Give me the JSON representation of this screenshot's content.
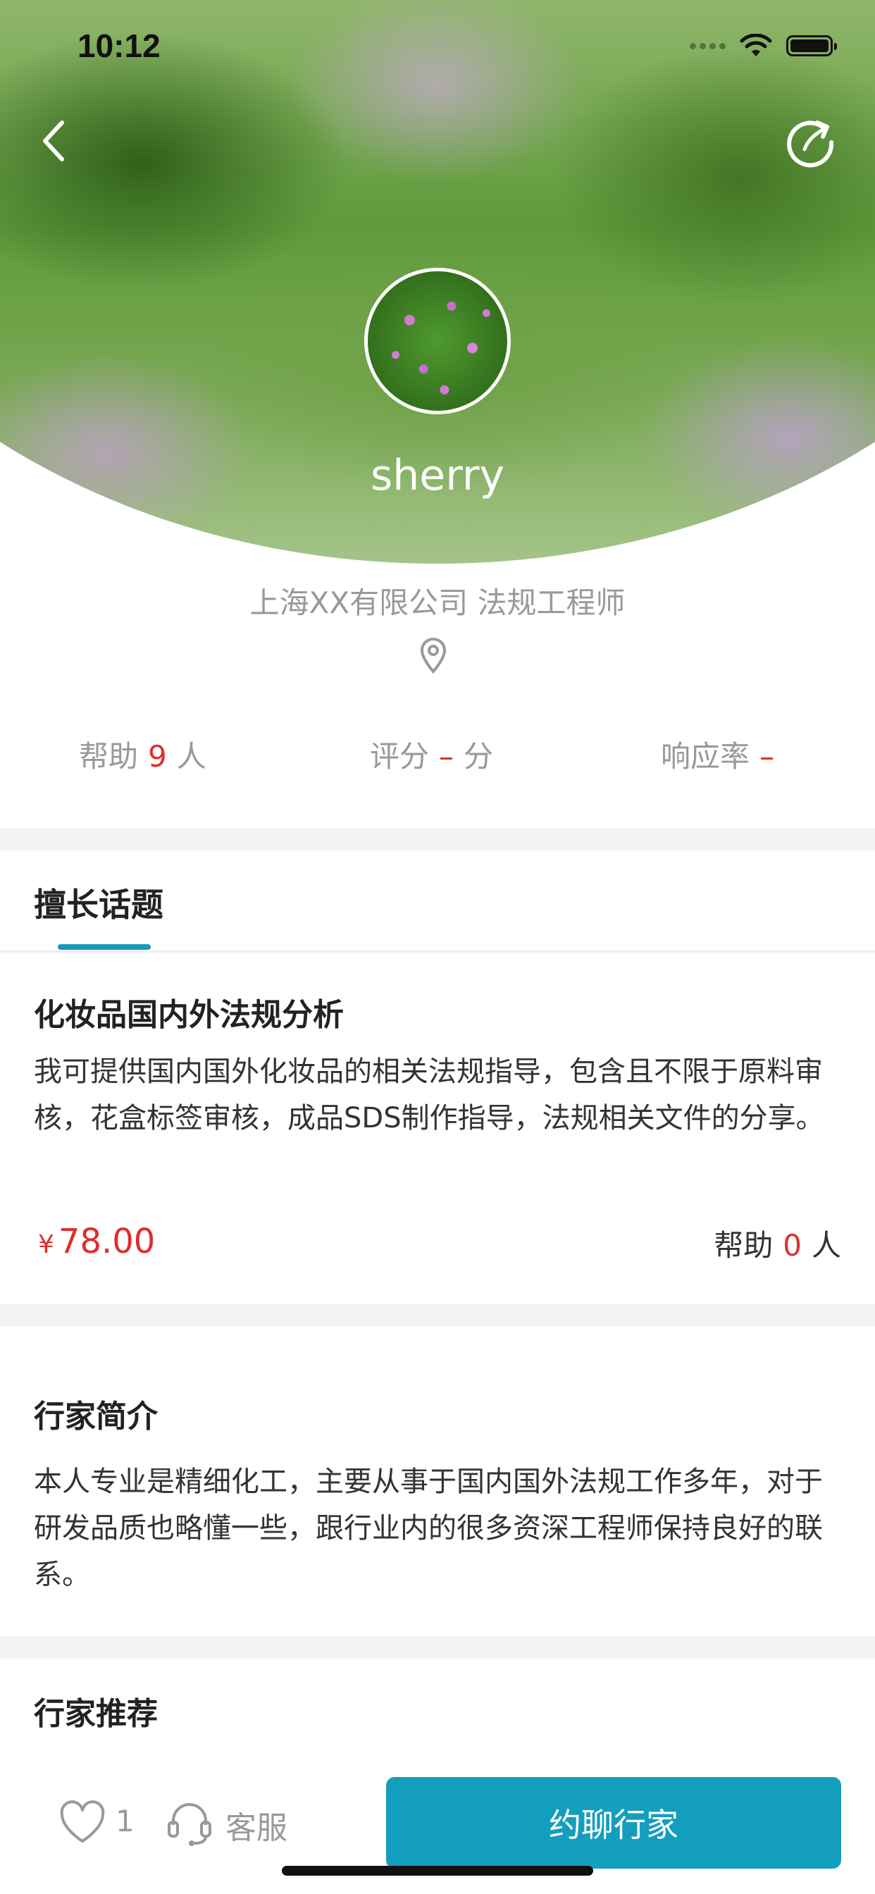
{
  "status_bar": {
    "time": "10:12"
  },
  "profile": {
    "name": "sherry",
    "company_title": "上海XX有限公司 法规工程师"
  },
  "stats": [
    {
      "label": "帮助",
      "value": "9",
      "unit": "人"
    },
    {
      "label": "评分",
      "value": "–",
      "unit": "分"
    },
    {
      "label": "响应率",
      "value": "–",
      "unit": ""
    }
  ],
  "tabs": {
    "active_label": "擅长话题"
  },
  "topic": {
    "title": "化妆品国内外法规分析",
    "description": "我可提供国内国外化妆品的相关法规指导，包含且不限于原料审核，花盒标签审核，成品SDS制作指导，法规相关文件的分享。",
    "currency": "¥",
    "price": "78.00",
    "help_label": "帮助",
    "help_count": "0",
    "help_unit": "人"
  },
  "intro": {
    "title": "行家简介",
    "text": "本人专业是精细化工，主要从事于国内国外法规工作多年，对于研发品质也略懂一些，跟行业内的很多资深工程师保持良好的联系。"
  },
  "recommend": {
    "title": "行家推荐"
  },
  "bottom_bar": {
    "like_count": "1",
    "service_label": "客服",
    "cta_label": "约聊行家"
  },
  "colors": {
    "accent": "#149ebd",
    "highlight": "#e02d2d"
  }
}
